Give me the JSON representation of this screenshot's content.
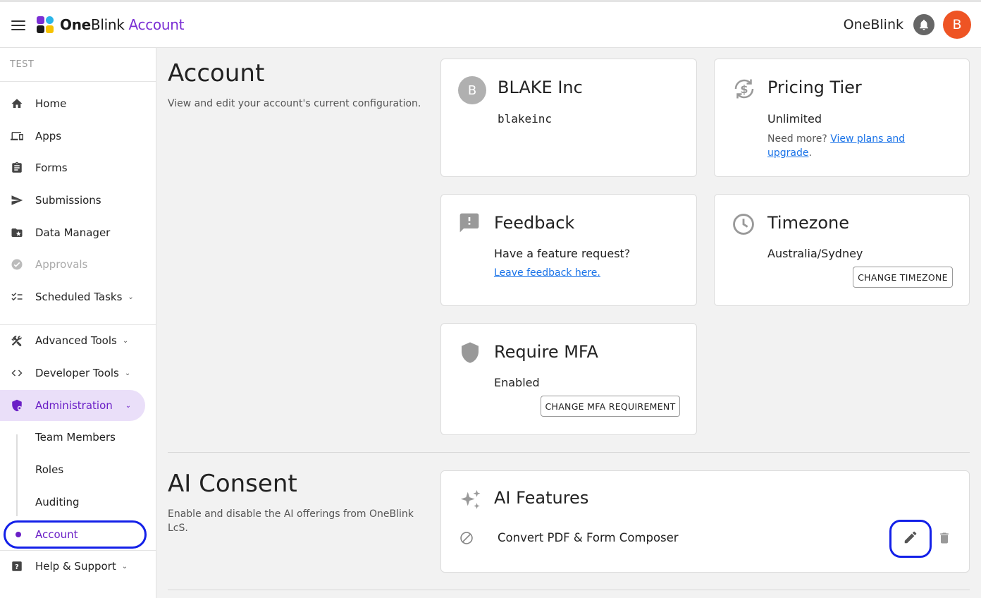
{
  "header": {
    "brand_bold": "One",
    "brand_thin": "Blink",
    "brand_accent": "Account",
    "org_name": "OneBlink",
    "avatar_initial": "B",
    "avatar_color": "#ee5424"
  },
  "sidebar": {
    "environment": "TEST",
    "items": [
      {
        "label": "Home",
        "icon": "home-icon"
      },
      {
        "label": "Apps",
        "icon": "devices-icon"
      },
      {
        "label": "Forms",
        "icon": "clipboard-icon"
      },
      {
        "label": "Submissions",
        "icon": "send-icon"
      },
      {
        "label": "Data Manager",
        "icon": "folder-star-icon"
      },
      {
        "label": "Approvals",
        "icon": "check-circle-icon"
      },
      {
        "label": "Scheduled Tasks",
        "icon": "checklist-icon"
      },
      {
        "label": "Advanced Tools",
        "icon": "tools-icon"
      },
      {
        "label": "Developer Tools",
        "icon": "code-icon"
      },
      {
        "label": "Administration",
        "icon": "admin-shield-icon"
      },
      {
        "label": "Help & Support",
        "icon": "help-icon"
      }
    ],
    "sub_items": [
      "Team Members",
      "Roles",
      "Auditing",
      "Account"
    ]
  },
  "account_section": {
    "title": "Account",
    "description": "View and edit your account's current configuration."
  },
  "org_card": {
    "avatar_initial": "B",
    "name": "BLAKE Inc",
    "slug": "blakeinc"
  },
  "pricing_card": {
    "title": "Pricing Tier",
    "tier": "Unlimited",
    "need_more": "Need more?",
    "link": "View plans and upgrade",
    "period": "."
  },
  "feedback_card": {
    "title": "Feedback",
    "question": "Have a feature request?",
    "link": "Leave feedback here."
  },
  "timezone_card": {
    "title": "Timezone",
    "value": "Australia/Sydney",
    "button": "CHANGE TIMEZONE"
  },
  "mfa_card": {
    "title": "Require MFA",
    "value": "Enabled",
    "button": "CHANGE MFA REQUIREMENT"
  },
  "ai_section": {
    "title": "AI Consent",
    "description": "Enable and disable the AI offerings from OneBlink LcS."
  },
  "ai_card": {
    "title": "AI Features",
    "feature": "Convert PDF & Form Composer"
  }
}
